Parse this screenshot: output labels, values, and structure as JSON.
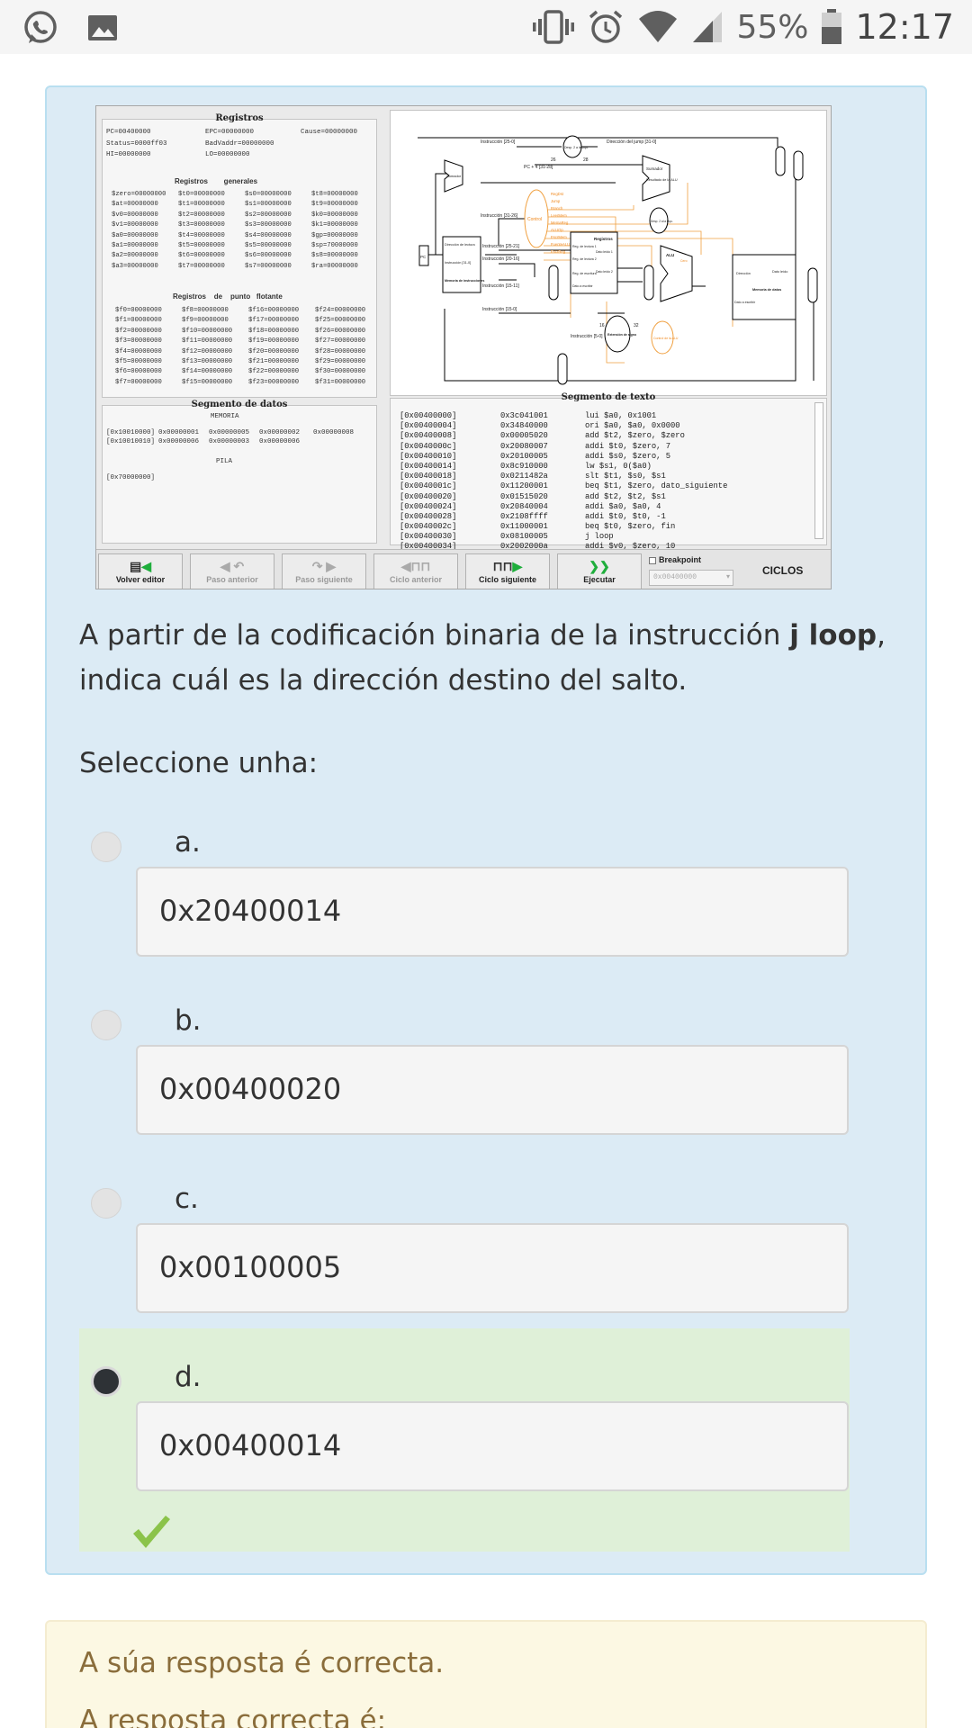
{
  "status_bar": {
    "icons": [
      "whatsapp-icon",
      "gallery-icon",
      "vibrate-icon",
      "alarm-icon",
      "wifi-icon",
      "signal-icon",
      "battery-icon"
    ],
    "battery": "55%",
    "time": "12:17"
  },
  "simulator": {
    "registers_title": "Registros",
    "special_registers": [
      "PC=00400000",
      "EPC=00000000",
      "Cause=00000000",
      "Status=0000ff03",
      "BadVaddr=00000000",
      "HI=00000000",
      "LO=00000000"
    ],
    "general_title": "Registros        generales",
    "general_registers": [
      "$zero=00000000",
      "$t0=00000000",
      "$s0=00000000",
      "$t8=00000000",
      "$at=00000000",
      "$t1=00000000",
      "$s1=00000000",
      "$t9=00000000",
      "$v0=00000000",
      "$t2=00000000",
      "$s2=00000000",
      "$k0=00000000",
      "$v1=00000000",
      "$t3=00000000",
      "$s3=00000000",
      "$k1=00000000",
      "$a0=00000000",
      "$t4=00000000",
      "$s4=00000000",
      "$gp=00000000",
      "$a1=00000000",
      "$t5=00000000",
      "$s5=00000000",
      "$sp=70000000",
      "$a2=00000000",
      "$t6=00000000",
      "$s6=00000000",
      "$s8=00000000",
      "$a3=00000000",
      "$t7=00000000",
      "$s7=00000000",
      "$ra=00000000"
    ],
    "float_title": "Registros    de    punto   flotante",
    "float_registers": [
      "$f0=00000000",
      "$f8=00000000",
      "$f16=00000000",
      "$f24=00000000",
      "$f1=00000000",
      "$f9=00000000",
      "$f17=00000000",
      "$f25=00000000",
      "$f2=00000000",
      "$f10=00000000",
      "$f18=00000000",
      "$f26=00000000",
      "$f3=00000000",
      "$f11=00000000",
      "$f19=00000000",
      "$f27=00000000",
      "$f4=00000000",
      "$f12=00000000",
      "$f20=00000000",
      "$f28=00000000",
      "$f5=00000000",
      "$f13=00000000",
      "$f21=00000000",
      "$f29=00000000",
      "$f6=00000000",
      "$f14=00000000",
      "$f22=00000000",
      "$f30=00000000",
      "$f7=00000000",
      "$f15=00000000",
      "$f23=00000000",
      "$f31=00000000"
    ],
    "data_segment": {
      "title": "Segmento de datos",
      "memory_label": "MEMORIA",
      "rows": [
        [
          "[0x10010000]",
          "0x00000001",
          "0x00000005",
          "0x00000002",
          "0x00000008"
        ],
        [
          "[0x10010010]",
          "0x00000006",
          "0x00000003",
          "0x00000006",
          ""
        ]
      ],
      "stack_label": "PILA",
      "stack_address": "[0x70000000]"
    },
    "text_segment": {
      "title": "Segmento de texto",
      "rows": [
        [
          "[0x00400000]",
          "0x3c041001",
          "lui $a0, 0x1001"
        ],
        [
          "[0x00400004]",
          "0x34840000",
          "ori $a0, $a0, 0x0000"
        ],
        [
          "[0x00400008]",
          "0x00005020",
          "add $t2, $zero, $zero"
        ],
        [
          "[0x0040000c]",
          "0x20080007",
          "addi $t0, $zero, 7"
        ],
        [
          "[0x00400010]",
          "0x20100005",
          "addi $s0, $zero, 5"
        ],
        [
          "[0x00400014]",
          "0x8c910000",
          "lw $s1, 0($a0)"
        ],
        [
          "[0x00400018]",
          "0x0211482a",
          "slt $t1, $s0, $s1"
        ],
        [
          "[0x0040001c]",
          "0x11200001",
          "beq $t1, $zero, dato_siguiente"
        ],
        [
          "[0x00400020]",
          "0x01515020",
          "add $t2, $t2, $s1"
        ],
        [
          "[0x00400024]",
          "0x20840004",
          "addi $a0, $a0, 4"
        ],
        [
          "[0x00400028]",
          "0x2108ffff",
          "addi $t0, $t0, -1"
        ],
        [
          "[0x0040002c]",
          "0x11000001",
          "beq $t0, $zero, fin"
        ],
        [
          "[0x00400030]",
          "0x08100005",
          "j loop"
        ],
        [
          "[0x00400034]",
          "0x2002000a",
          "addi $v0, $zero, 10"
        ]
      ]
    },
    "datapath_labels": {
      "desp_top": "Desp. 2 a la izqu.",
      "n26": "26",
      "n28": "28",
      "instr_25_0": "Instrucción [25-0]",
      "jump_addr": "Dirección del jump [31-0]",
      "pc4": "PC + 4 [31-28]",
      "sumador": "Sumador",
      "sumador2": "Sumador",
      "resultado_alu": "Resultado de la ALU",
      "control": "Control",
      "instr_31_26": "Instrucción [31-26]",
      "instr_25_21": "Instrucción [25-21]",
      "instr_20_16": "Instrucción [20-16]",
      "instr_15_11": "Instrucción [15-11]",
      "instr_15_0": "Instrucción [15-0]",
      "instr_5_0": "Instrucción [5-0]",
      "pc": "PC",
      "dir_lectura": "Dirección de lectura",
      "instruccion": "Instrucción [31-0]",
      "mem_instr": "Memoria de instrucciones",
      "registros": "Registros",
      "reg_lect1": "Reg. de lectura 1",
      "reg_lect2": "Reg. de lectura 2",
      "reg_escr": "Reg. de escritura",
      "dato_escr": "Dato a escribir",
      "dato_leido1": "Dato leído 1",
      "dato_leido2": "Dato leído 2",
      "alu": "ALU",
      "cero": "Cero",
      "direccion": "Dirección",
      "dato_leido": "Dato leído",
      "mem_datos": "Memoria de datos",
      "dato_escr2": "Dato a escribir",
      "n16": "16",
      "n32": "32",
      "ext_signo": "Extensión de signo",
      "control_alu": "Control de la ALU",
      "desp2": "Desp. 2 a la izqu.",
      "mux": "M u x",
      "signals": [
        "RegDst",
        "Jump",
        "Branch",
        "LeerMem",
        "MemaReg",
        "ALUOp",
        "EscrMem",
        "FuenteALU",
        "EscrReg"
      ]
    },
    "toolbar": {
      "volver_editor": "Volver editor",
      "paso_anterior": "Paso anterior",
      "paso_siguiente": "Paso siguiente",
      "ciclo_anterior": "Ciclo anterior",
      "ciclo_siguiente": "Ciclo siguiente",
      "ejecutar": "Ejecutar",
      "breakpoint": "Breakpoint",
      "breakpoint_value": "0x00400000",
      "ciclos": "CICLOS"
    }
  },
  "question": {
    "text_before": "A partir de la codificación binaria de la instrucción ",
    "instruction": "j loop",
    "text_after": ", indica cuál es la dirección destino del salto.",
    "prompt": "Seleccione unha:",
    "options": [
      {
        "letter": "a.",
        "value": "0x20400014"
      },
      {
        "letter": "b.",
        "value": "0x00400020"
      },
      {
        "letter": "c.",
        "value": "0x00100005"
      },
      {
        "letter": "d.",
        "value": "0x00400014"
      }
    ],
    "selected_index": 3
  },
  "feedback": {
    "result": "A súa resposta é correcta.",
    "correct_intro": "A resposta correcta é:"
  },
  "colors": {
    "card_bg": "#dcebf5",
    "selected_bg": "#dff0d8",
    "check_green": "#8bc34a",
    "feedback_bg": "#fcf8e3",
    "feedback_text": "#8a6d3b",
    "signal_orange": "#f0a040"
  }
}
